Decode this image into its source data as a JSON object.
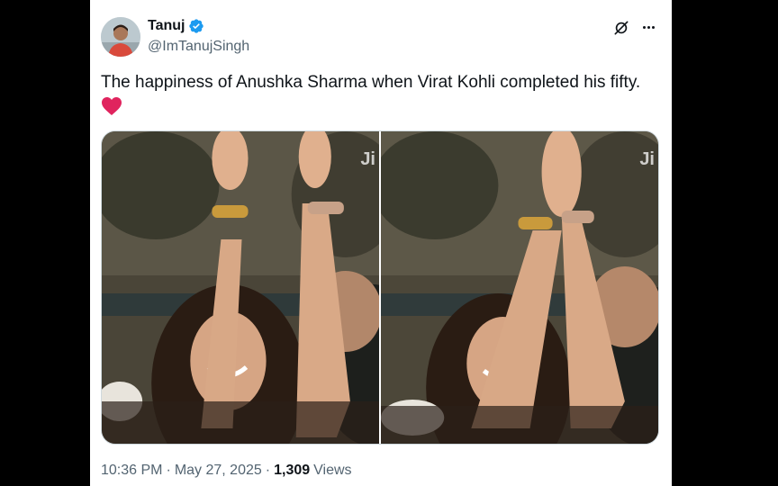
{
  "author": {
    "name": "Tanuj",
    "handle": "@ImTanujSingh",
    "verified": true,
    "verified_color": "#1d9bf0"
  },
  "tweet": {
    "text": "The happiness of Anushka Sharma when Virat Kohli completed his fifty.",
    "emoji_icon": "red-heart-icon"
  },
  "media": {
    "count": 2,
    "watermark": "Ji"
  },
  "meta": {
    "time": "10:36 PM",
    "separator": "·",
    "date": "May 27, 2025",
    "separator2": "·",
    "views_count": "1,309",
    "views_label": "Views"
  },
  "icons": {
    "grok": "grok-icon",
    "more": "more-options-icon",
    "verified": "verified-badge-icon"
  }
}
